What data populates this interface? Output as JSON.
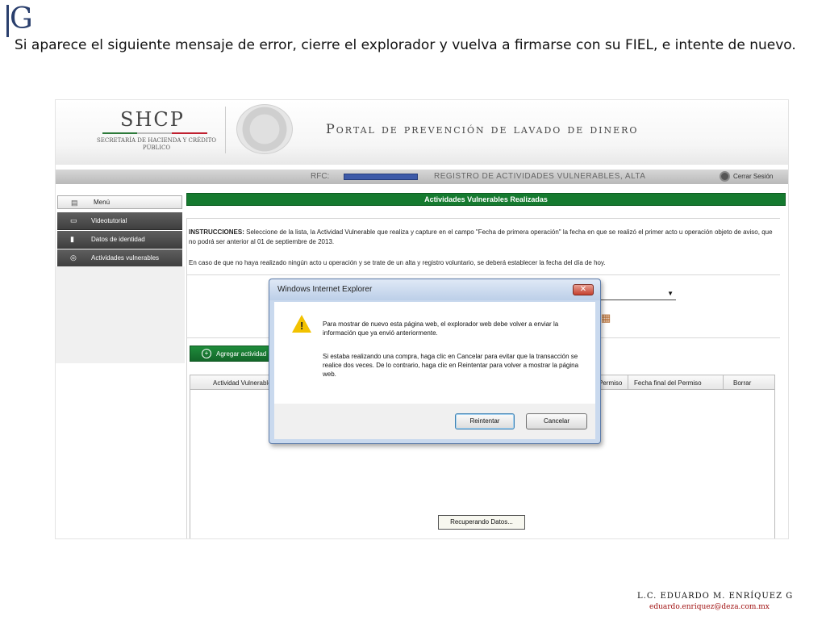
{
  "slide": {
    "logo_letter": "G",
    "instruction": "Si aparece el siguiente mensaje de error, cierre el explorador y vuelva a firmarse con su FIEL, e intente de nuevo.",
    "footer_name": "L.C. EDUARDO M. ENRÍQUEZ G",
    "footer_email": "eduardo.enriquez@deza.com.mx"
  },
  "portal": {
    "shcp_logo": "SHCP",
    "shcp_subtitle": "SECRETARÍA DE HACIENDA Y CRÉDITO PÚBLICO",
    "title": "Portal de prevención de lavado de dinero",
    "rfc_label": "RFC:",
    "registro_label": "REGISTRO DE ACTIVIDADES VULNERABLES, ALTA",
    "cerrar_sesion": "Cerrar Sesión"
  },
  "sidebar": {
    "menu_label": "Menú",
    "items": [
      {
        "label": "Videotutorial",
        "icon": "video-icon"
      },
      {
        "label": "Datos de identidad",
        "icon": "id-icon"
      },
      {
        "label": "Actividades vulnerables",
        "icon": "activities-icon"
      }
    ]
  },
  "main": {
    "section_title": "Actividades Vulnerables Realizadas",
    "instructions_bold": "INSTRUCCIONES:",
    "instructions_text": " Seleccione de la lista, la Actividad Vulnerable que realiza y capture en el campo \"Fecha de primera operación\" la fecha en que se realizó el primer acto u operación objeto de aviso, que no podrá ser anterior al 01 de septiembre de 2013.",
    "instructions_note": "En caso de que no haya realizado ningún acto u operación y se trate de un alta y registro voluntario, se deberá establecer la fecha del día de hoy.",
    "agregar_label": "Agregar actividad",
    "grid_headers": [
      "Actividad Vulnerable",
      "Permiso",
      "Fecha final del Permiso",
      "Borrar"
    ],
    "loading_text": "Recuperando Datos..."
  },
  "dialog": {
    "title": "Windows Internet Explorer",
    "close_glyph": "✕",
    "message1": "Para mostrar de nuevo esta página web, el explorador web debe volver a enviar la información que ya envió anteriormente.",
    "message2": "Si estaba realizando una compra, haga clic en Cancelar para evitar que la transacción se realice dos veces. De lo contrario, haga clic en Reintentar para volver a mostrar la página web.",
    "retry_label": "Reintentar",
    "cancel_label": "Cancelar",
    "warning_icon": "warning-icon"
  }
}
